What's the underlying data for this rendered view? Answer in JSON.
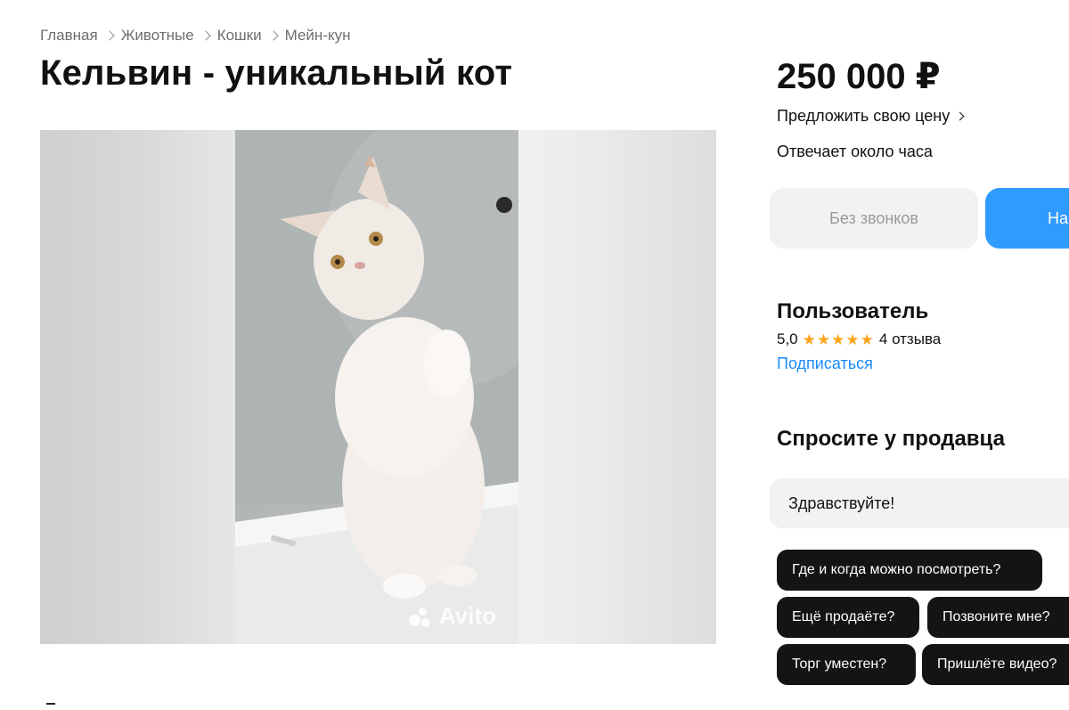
{
  "breadcrumbs": [
    {
      "label": "Главная"
    },
    {
      "label": "Животные"
    },
    {
      "label": "Кошки"
    },
    {
      "label": "Мейн-кун"
    }
  ],
  "listing": {
    "title": "Кельвин - уникальный кот",
    "watermark": "Avito"
  },
  "sidebar": {
    "price": "250 000 ₽",
    "offer_price_link": "Предложить свою цену",
    "response_time": "Отвечает около часа",
    "no_calls_button": "Без звонков",
    "write_button": "Написать"
  },
  "seller": {
    "name": "Пользователь",
    "rating": "5,0",
    "stars": 5,
    "reviews": "4 отзыва",
    "subscribe": "Подписаться"
  },
  "ask_seller": {
    "title": "Спросите у продавца",
    "message_value": "Здравствуйте!",
    "quick_questions": [
      "Где и когда можно посмотреть?",
      "Ещё продаёте?",
      "Позвоните мне?",
      "Торг уместен?",
      "Пришлёте видео?"
    ]
  },
  "colors": {
    "accent_blue": "#2f9bff",
    "link_blue": "#1a8cff",
    "star": "#ffa41c",
    "chip_bg": "#141414"
  },
  "icons": [
    "chevron-right-icon",
    "star-icon",
    "avito-logo-icon"
  ]
}
